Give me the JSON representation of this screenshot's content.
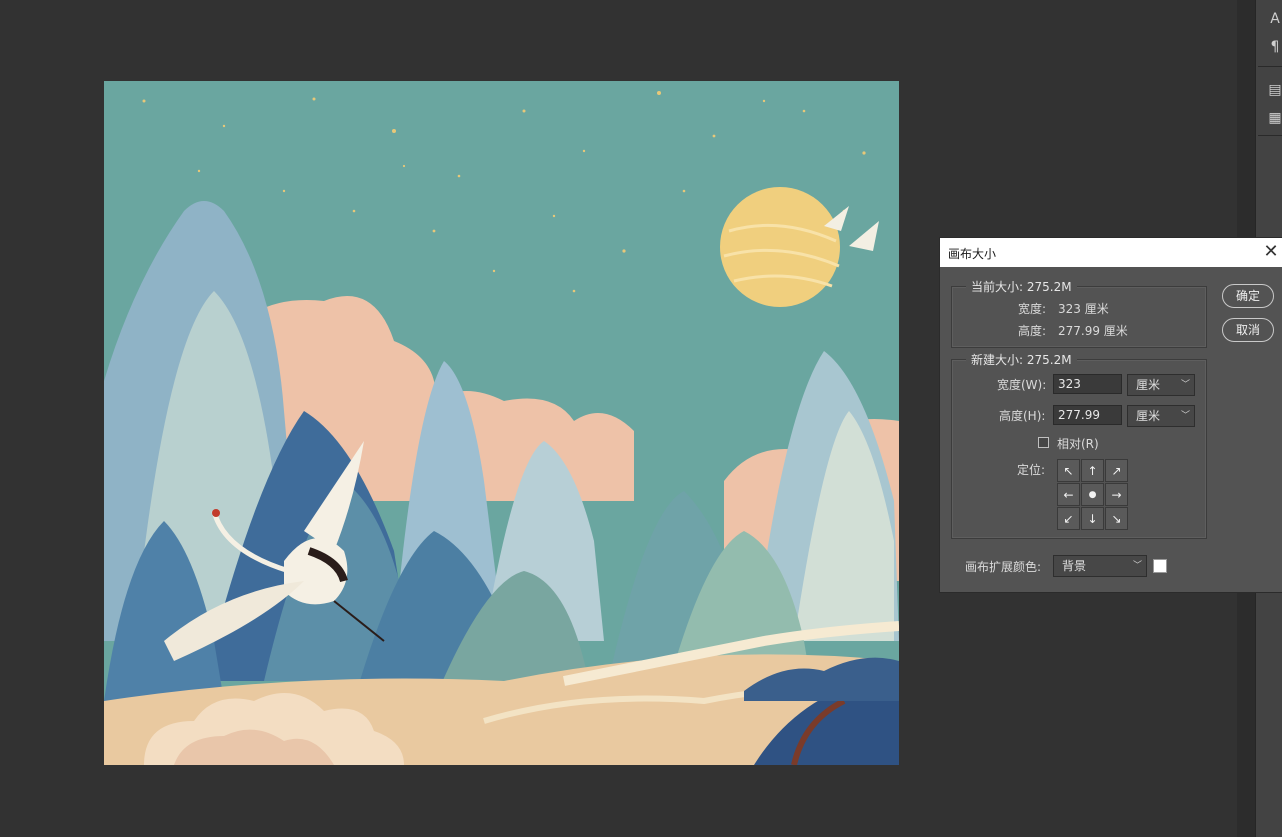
{
  "side_panel": {
    "icons": [
      "character-icon",
      "paragraph-icon",
      "paragraph-styles-icon",
      "character-styles-icon"
    ],
    "glyphs": [
      "A",
      "¶",
      "▤",
      "▦"
    ]
  },
  "dialog": {
    "title": "画布大小",
    "current_size": {
      "legend": "当前大小: 275.2M",
      "width_label": "宽度:",
      "width_value": "323 厘米",
      "height_label": "高度:",
      "height_value": "277.99 厘米"
    },
    "new_size": {
      "legend": "新建大小: 275.2M",
      "width_label": "宽度(W):",
      "width_value": "323",
      "width_unit": "厘米",
      "height_label": "高度(H):",
      "height_value": "277.99",
      "height_unit": "厘米",
      "relative_label": "相对(R)",
      "relative_checked": false,
      "anchor_label": "定位:",
      "anchor_arrows": [
        "↖",
        "↑",
        "↗",
        "←",
        "●",
        "→",
        "↙",
        "↓",
        "↘"
      ]
    },
    "extension_color_label": "画布扩展颜色:",
    "extension_color_value": "背景",
    "extension_swatch_color": "#ffffff",
    "ok_label": "确定",
    "cancel_label": "取消"
  },
  "colors": {
    "workspace": "#323232",
    "dialog_bg": "#535353",
    "art_sky": "#6aa6a0",
    "art_moon": "#f0cf7e"
  }
}
